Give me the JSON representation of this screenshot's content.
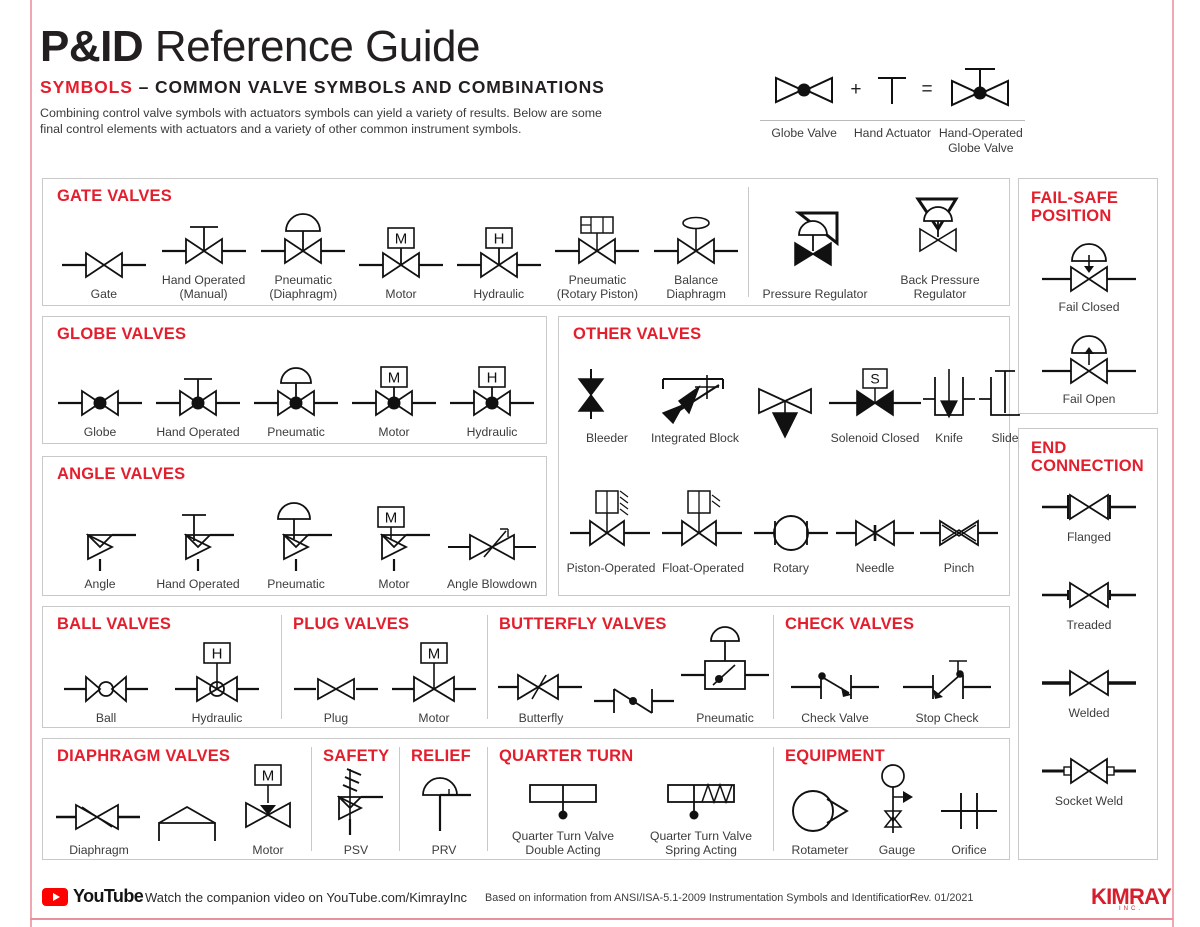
{
  "header": {
    "title_bold": "P&ID",
    "title_rest": " Reference Guide",
    "subtitle_red": "SYMBOLS",
    "subtitle_dark": " – COMMON VALVE SYMBOLS AND COMBINATIONS",
    "intro": "Combining control valve symbols with actuators symbols can yield a variety of results. Below are some final control elements with actuators and a variety of other common instrument symbols."
  },
  "equation": {
    "plus": "+",
    "equals": "=",
    "label_1": "Globe\nValve",
    "label_2": "Hand\nActuator",
    "label_3": "Hand-Operated\nGlobe Valve"
  },
  "sections": {
    "gate": {
      "title": "GATE VALVES",
      "items": [
        {
          "label": "Gate"
        },
        {
          "label": "Hand Operated\n(Manual)"
        },
        {
          "label": "Pneumatic\n(Diaphragm)"
        },
        {
          "label": "Motor",
          "badge": "M"
        },
        {
          "label": "Hydraulic",
          "badge": "H"
        },
        {
          "label": "Pneumatic\n(Rotary Piston)"
        },
        {
          "label": "Balance\nDiaphragm"
        }
      ]
    },
    "regulators": {
      "items": [
        {
          "label": "Pressure Regulator"
        },
        {
          "label": "Back Pressure Regulator"
        }
      ]
    },
    "globe": {
      "title": "GLOBE VALVES",
      "items": [
        {
          "label": "Globe"
        },
        {
          "label": "Hand Operated"
        },
        {
          "label": "Pneumatic"
        },
        {
          "label": "Motor",
          "badge": "M"
        },
        {
          "label": "Hydraulic",
          "badge": "H"
        }
      ]
    },
    "angle": {
      "title": "ANGLE VALVES",
      "items": [
        {
          "label": "Angle"
        },
        {
          "label": "Hand Operated"
        },
        {
          "label": "Pneumatic"
        },
        {
          "label": "Motor",
          "badge": "M"
        },
        {
          "label": "Angle Blowdown"
        }
      ]
    },
    "other": {
      "title": "OTHER VALVES",
      "items_row1": [
        {
          "label": "Bleeder"
        },
        {
          "label": "Integrated Block"
        },
        {
          "label": "Solenoid Closed",
          "badge": "S"
        },
        {
          "label": "Knife"
        },
        {
          "label": "Slide"
        }
      ],
      "items_row2": [
        {
          "label": "Piston-Operated"
        },
        {
          "label": "Float-Operated"
        },
        {
          "label": "Rotary"
        },
        {
          "label": "Needle"
        },
        {
          "label": "Pinch"
        }
      ]
    },
    "ball": {
      "title": "BALL VALVES",
      "items": [
        {
          "label": "Ball"
        },
        {
          "label": "Hydraulic",
          "badge": "H"
        }
      ]
    },
    "plug": {
      "title": "PLUG VALVES",
      "items": [
        {
          "label": "Plug"
        },
        {
          "label": "Motor",
          "badge": "M"
        }
      ]
    },
    "butterfly": {
      "title": "BUTTERFLY VALVES",
      "items": [
        {
          "label": "Butterfly"
        },
        {
          "label": ""
        },
        {
          "label": "Pneumatic"
        }
      ]
    },
    "check": {
      "title": "CHECK VALVES",
      "items": [
        {
          "label": "Check Valve"
        },
        {
          "label": "Stop Check"
        }
      ]
    },
    "diaphragm": {
      "title": "DIAPHRAGM VALVES",
      "items": [
        {
          "label": "Diaphragm"
        },
        {
          "label": ""
        },
        {
          "label": "Motor",
          "badge": "M"
        }
      ]
    },
    "safety": {
      "title": "SAFETY",
      "items": [
        {
          "label": "PSV"
        }
      ]
    },
    "relief": {
      "title": "RELIEF",
      "items": [
        {
          "label": "PRV"
        }
      ]
    },
    "quarter": {
      "title": "QUARTER TURN",
      "items": [
        {
          "label": "Quarter Turn Valve\nDouble Acting"
        },
        {
          "label": "Quarter Turn Valve\nSpring Acting"
        }
      ]
    },
    "equipment": {
      "title": "EQUIPMENT",
      "items": [
        {
          "label": "Rotameter"
        },
        {
          "label": "Gauge"
        },
        {
          "label": "Orifice"
        }
      ]
    },
    "failsafe": {
      "title_line1": "FAIL-SAFE",
      "title_line2": "POSITION",
      "items": [
        {
          "label": "Fail Closed"
        },
        {
          "label": "Fail Open"
        }
      ]
    },
    "endconn": {
      "title_line1": "END",
      "title_line2": "CONNECTION",
      "items": [
        {
          "label": "Flanged"
        },
        {
          "label": "Treaded"
        },
        {
          "label": "Welded"
        },
        {
          "label": "Socket Weld"
        }
      ]
    }
  },
  "footer": {
    "youtube_word": "YouTube",
    "watch_text": "Watch the companion video on YouTube.com/KimrayInc",
    "source_text": "Based on information from ANSI/ISA-5.1-2009 Instrumentation Symbols and Identification",
    "revision": "Rev. 01/2021",
    "brand": "KIMRAY",
    "brand_sub": "INC."
  },
  "colors": {
    "accent_red": "#e31e2d",
    "rule_pink": "#f0a7b2",
    "panel_border": "#c9c9c9",
    "ink": "#231f20"
  }
}
